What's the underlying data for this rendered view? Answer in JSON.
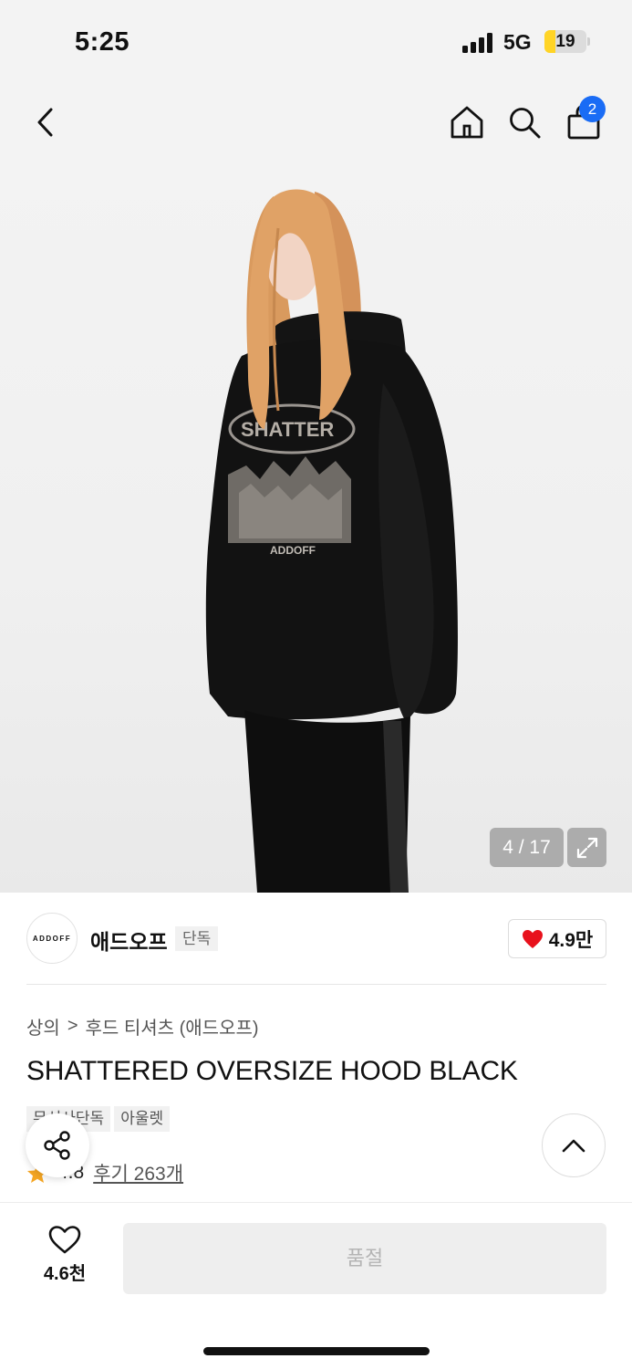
{
  "status": {
    "time": "5:25",
    "network": "5G",
    "battery": "19"
  },
  "nav": {
    "cart_count": "2"
  },
  "gallery": {
    "counter": "4 / 17",
    "print_text": "SHATTER",
    "print_brand": "ADDOFF"
  },
  "brand": {
    "logo_text": "ADDOFF",
    "name": "애드오프",
    "tag": "단독",
    "likes": "4.9만"
  },
  "breadcrumb": {
    "category": "상의",
    "separator": ">",
    "subcategory": "후드 티셔츠 (애드오프)"
  },
  "product": {
    "title": "SHATTERED OVERSIZE HOOD BLACK",
    "tags": [
      "무신사단독",
      "아울렛"
    ],
    "rating": "4.8",
    "reviews": "후기 263개"
  },
  "bottom": {
    "wish_count": "4.6천",
    "buy_label": "품절"
  },
  "colors": {
    "accent": "#1a6cf5",
    "heart": "#e8111c",
    "star": "#f5a623"
  },
  "icons": [
    "back-icon",
    "home-icon",
    "search-icon",
    "cart-icon",
    "expand-icon",
    "heart-icon",
    "share-icon",
    "chevron-up-icon",
    "star-icon",
    "signal-icon",
    "battery-icon"
  ]
}
